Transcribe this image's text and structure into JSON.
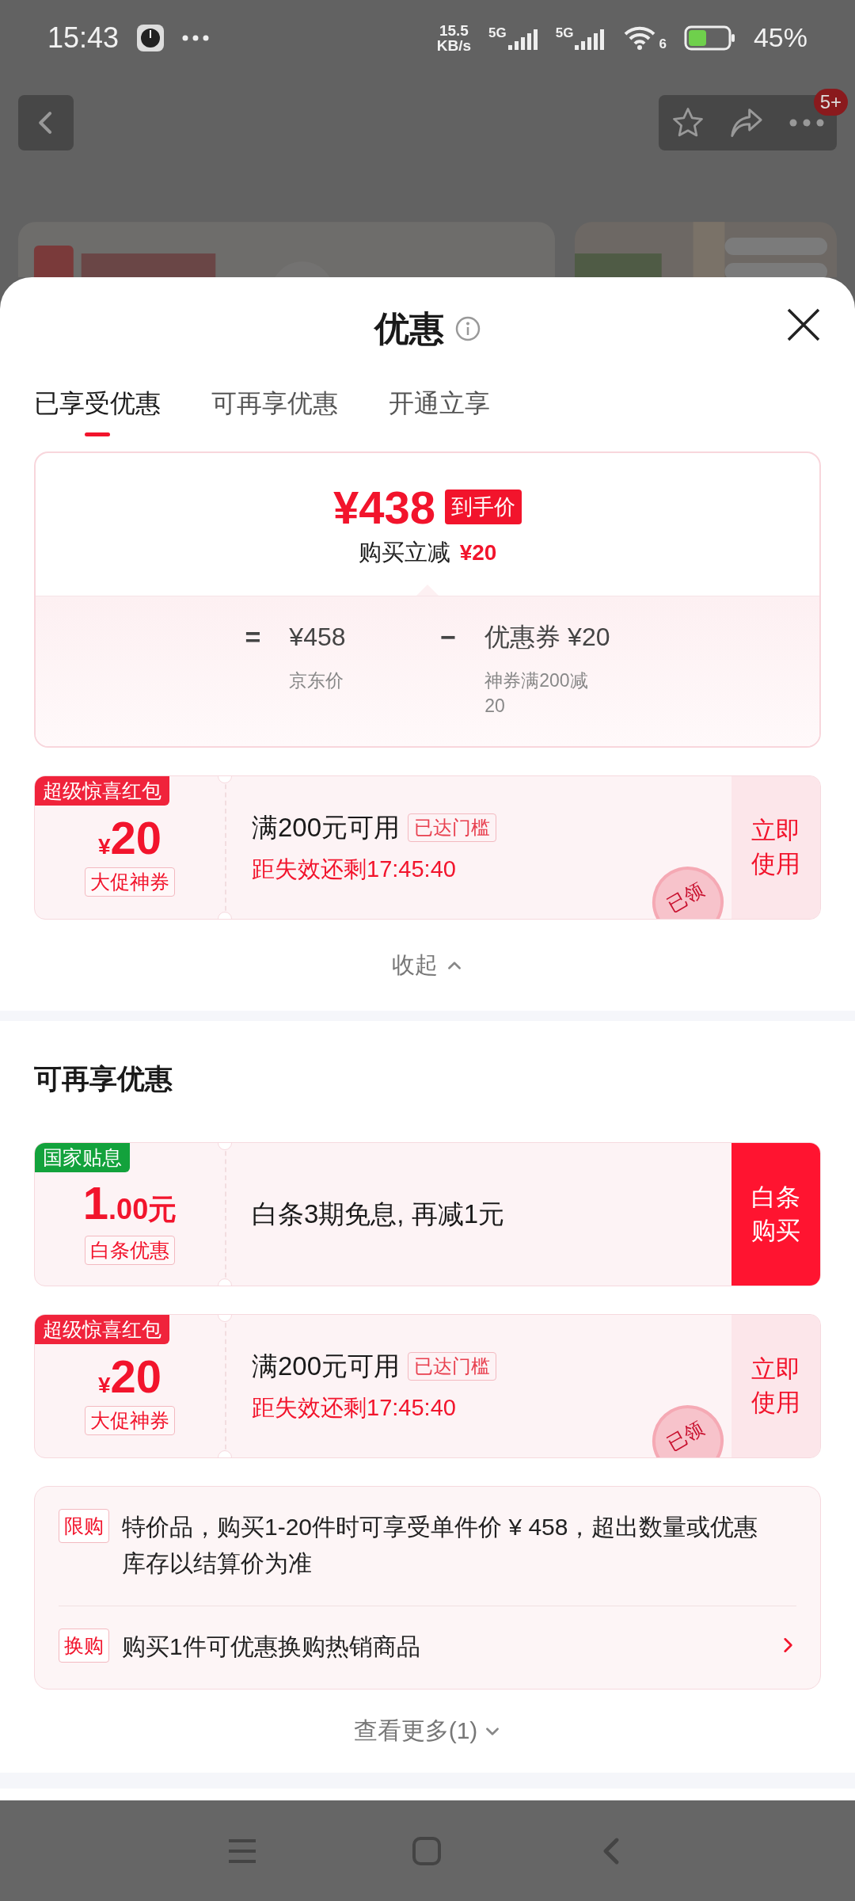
{
  "status_bar": {
    "time": "15:43",
    "net_speed": "15.5",
    "net_unit": "KB/s",
    "sim_labels": [
      "5G",
      "5G"
    ],
    "wifi_label": "6",
    "battery": "45%"
  },
  "page_nav": {
    "badge": "5+"
  },
  "sheet": {
    "title": "优惠",
    "tabs": [
      {
        "label": "已享受优惠",
        "selected": true
      },
      {
        "label": "可再享优惠",
        "selected": false
      },
      {
        "label": "开通立享",
        "selected": false
      }
    ],
    "summary": {
      "price": "¥438",
      "price_tag": "到手价",
      "reduction_label": "购买立减",
      "reduction": "¥20",
      "equals": "=",
      "minus": "−",
      "terms": [
        {
          "value": "¥458",
          "label": "京东价"
        },
        {
          "value": "优惠券 ¥20",
          "label": "神券满200减20"
        }
      ]
    },
    "applied_coupons": [
      {
        "kind": "coupon",
        "badge": "超级惊喜红包",
        "color": "#f0233b",
        "amount_prefix": "¥",
        "amount": "20",
        "tag": "大促神券",
        "condition": "满200元可用",
        "threshold": "已达门槛",
        "countdown": "距失效还剩17:45:40",
        "action": "立即使用",
        "stamp": "已领"
      }
    ],
    "collapse": "收起",
    "more_section": {
      "title": "可再享优惠",
      "coupons": [
        {
          "kind": "payment",
          "badge": "国家贴息",
          "color": "#13a23c",
          "amount": "1",
          "amount_suffix": ".00元",
          "tag": "白条优惠",
          "condition": "白条3期免息, 再减1元",
          "action": "白条购买"
        },
        {
          "kind": "coupon",
          "badge": "超级惊喜红包",
          "color": "#f0233b",
          "amount_prefix": "¥",
          "amount": "20",
          "tag": "大促神券",
          "condition": "满200元可用",
          "threshold": "已达门槛",
          "countdown": "距失效还剩17:45:40",
          "action": "立即使用",
          "stamp": "已领"
        }
      ],
      "notices": [
        {
          "tag": "限购",
          "text": "特价品，购买1-20件时可享受单件价 ¥ 458，超出数量或优惠库存以结算价为准",
          "has_arrow": false
        },
        {
          "tag": "换购",
          "text": "购买1件可优惠换购热销商品",
          "has_arrow": true
        }
      ],
      "see_more": "查看更多(1)"
    }
  }
}
